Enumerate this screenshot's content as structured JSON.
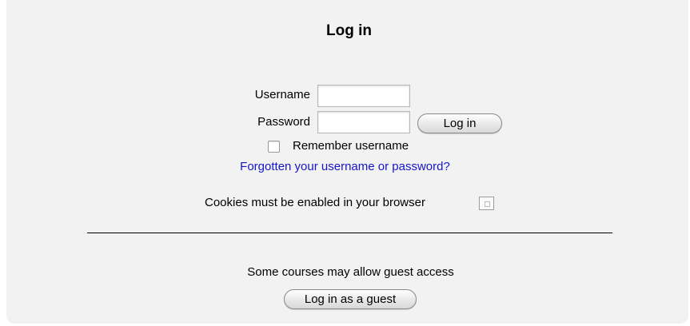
{
  "login": {
    "title": "Log in",
    "username_label": "Username",
    "username_value": "",
    "password_label": "Password",
    "password_value": "",
    "login_button": "Log in",
    "remember_label": "Remember username",
    "remember_checked": false,
    "forgot_link": "Forgotten your username or password?",
    "cookies_text": "Cookies must be enabled in your browser",
    "help_icon": "help-icon"
  },
  "guest": {
    "text": "Some courses may allow guest access",
    "button": "Log in as a guest"
  }
}
